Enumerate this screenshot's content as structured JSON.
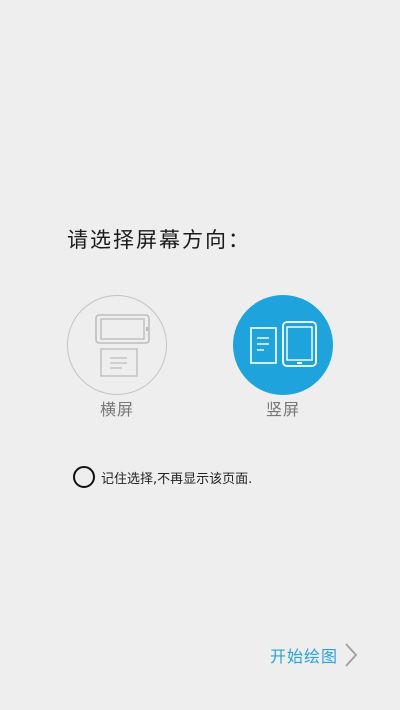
{
  "prompt": {
    "title": "请选择屏幕方向："
  },
  "options": [
    {
      "label": "横屏",
      "icon": "landscape-orientation-icon",
      "selected": false
    },
    {
      "label": "竖屏",
      "icon": "portrait-orientation-icon",
      "selected": true
    }
  ],
  "remember": {
    "label": "记住选择,不再显示该页面.",
    "checked": false
  },
  "start": {
    "label": "开始绘图",
    "icon": "chevron-right-icon"
  },
  "colors": {
    "background": "#eeeeee",
    "accent": "#1fa3dc",
    "link": "#2aa2d6",
    "unselected_outline": "#c3c3c3"
  }
}
